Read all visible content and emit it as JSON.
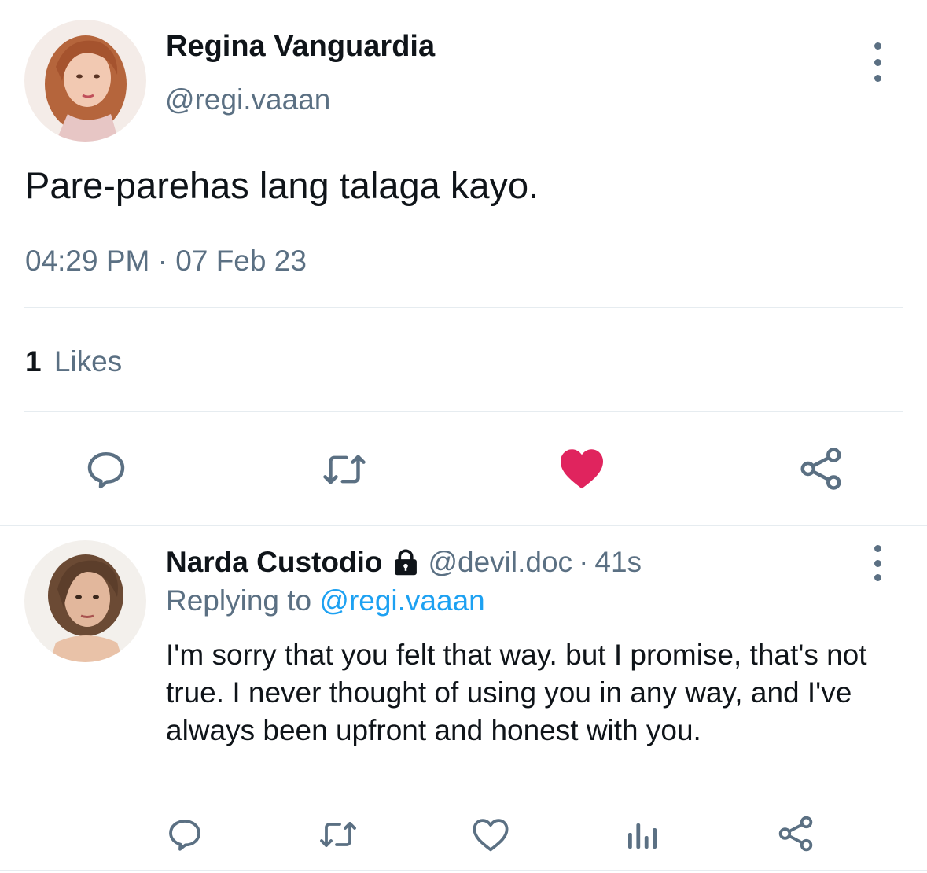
{
  "main_tweet": {
    "author_name": "Regina Vanguardia",
    "author_handle": "@regi.vaaan",
    "text": "Pare-parehas lang talaga kayo.",
    "time": "04:29 PM",
    "date_separator": "·",
    "date": "07 Feb 23",
    "likes_count": "1",
    "likes_label": "Likes",
    "liked": true,
    "actions": [
      "reply-icon",
      "retweet-icon",
      "heart-filled-icon",
      "share-icon"
    ]
  },
  "reply": {
    "author_name": "Narda Custodio",
    "protected": true,
    "author_handle": "@devil.doc",
    "separator": "·",
    "time": "41s",
    "replying_prefix": "Replying to",
    "replying_to": "@regi.vaaan",
    "text": "I'm sorry that you felt that way. but I promise, that's not true. I never thought of using you in any way, and I've always been upfront and honest with you.",
    "actions": [
      "reply-icon",
      "retweet-icon",
      "heart-outline-icon",
      "analytics-icon",
      "share-icon"
    ]
  },
  "colors": {
    "text_primary": "#0f1419",
    "text_secondary": "#5b7083",
    "link": "#1da1f2",
    "like": "#e0245e",
    "divider": "#e6ecf0"
  }
}
